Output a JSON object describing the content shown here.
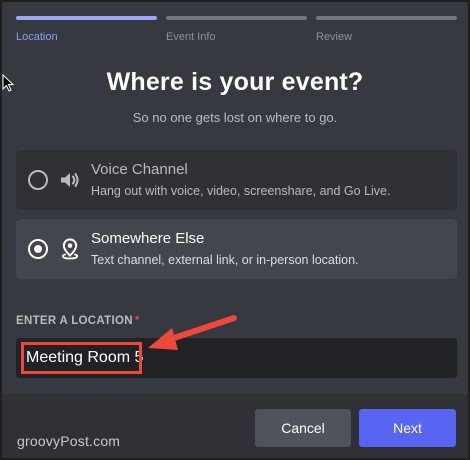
{
  "steps": [
    {
      "label": "Location",
      "active": true
    },
    {
      "label": "Event Info",
      "active": false
    },
    {
      "label": "Review",
      "active": false
    }
  ],
  "header": {
    "title": "Where is your event?",
    "subtitle": "So no one gets lost on where to go."
  },
  "options": [
    {
      "title": "Voice Channel",
      "description": "Hang out with voice, video, screenshare, and Go Live.",
      "icon": "speaker-icon",
      "selected": false
    },
    {
      "title": "Somewhere Else",
      "description": "Text channel, external link, or in-person location.",
      "icon": "location-pin-icon",
      "selected": true
    }
  ],
  "location": {
    "label": "ENTER A LOCATION",
    "required_mark": "*",
    "value": "Meeting Room 5"
  },
  "footer": {
    "cancel_label": "Cancel",
    "next_label": "Next"
  },
  "watermark": "groovyPost.com",
  "colors": {
    "background": "#36393f",
    "option_bg": "#2f3136",
    "option_selected_bg": "#42464d",
    "input_bg": "#202225",
    "accent": "#5865f2",
    "active_step": "#9ba6f4",
    "highlight": "#ef473a"
  }
}
